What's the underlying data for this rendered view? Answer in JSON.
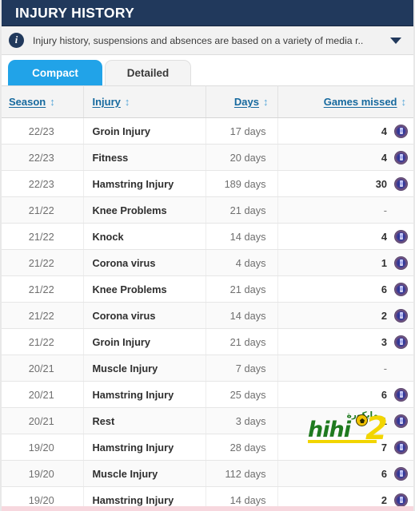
{
  "header": {
    "title": "INJURY HISTORY",
    "info_icon": "info-icon",
    "info_text": "Injury history, suspensions and absences are based on a variety of media r..",
    "expand_icon": "chevron-down-icon"
  },
  "tabs": [
    {
      "label": "Compact",
      "active": true
    },
    {
      "label": "Detailed",
      "active": false
    }
  ],
  "table": {
    "columns": [
      {
        "label": "Season",
        "sort": "↕",
        "align": "left"
      },
      {
        "label": "Injury",
        "sort": "↕",
        "align": "left"
      },
      {
        "label": "Days",
        "sort": "↕",
        "align": "right"
      },
      {
        "label": "Games missed",
        "sort": "↕",
        "align": "right"
      }
    ],
    "rows": [
      {
        "season": "22/23",
        "injury": "Groin Injury",
        "days": "17 days",
        "games": "4",
        "crest": true
      },
      {
        "season": "22/23",
        "injury": "Fitness",
        "days": "20 days",
        "games": "4",
        "crest": true
      },
      {
        "season": "22/23",
        "injury": "Hamstring Injury",
        "days": "189 days",
        "games": "30",
        "crest": true
      },
      {
        "season": "21/22",
        "injury": "Knee Problems",
        "days": "21 days",
        "games": "-",
        "crest": false
      },
      {
        "season": "21/22",
        "injury": "Knock",
        "days": "14 days",
        "games": "4",
        "crest": true
      },
      {
        "season": "21/22",
        "injury": "Corona virus",
        "days": "4 days",
        "games": "1",
        "crest": true
      },
      {
        "season": "21/22",
        "injury": "Knee Problems",
        "days": "21 days",
        "games": "6",
        "crest": true
      },
      {
        "season": "21/22",
        "injury": "Corona virus",
        "days": "14 days",
        "games": "2",
        "crest": true
      },
      {
        "season": "21/22",
        "injury": "Groin Injury",
        "days": "21 days",
        "games": "3",
        "crest": true
      },
      {
        "season": "20/21",
        "injury": "Muscle Injury",
        "days": "7 days",
        "games": "-",
        "crest": false
      },
      {
        "season": "20/21",
        "injury": "Hamstring Injury",
        "days": "25 days",
        "games": "6",
        "crest": true
      },
      {
        "season": "20/21",
        "injury": "Rest",
        "days": "3 days",
        "games": "1",
        "crest": true
      },
      {
        "season": "19/20",
        "injury": "Hamstring Injury",
        "days": "28 days",
        "games": "7",
        "crest": true
      },
      {
        "season": "19/20",
        "injury": "Muscle Injury",
        "days": "112 days",
        "games": "6",
        "crest": true
      },
      {
        "season": "19/20",
        "injury": "Hamstring Injury",
        "days": "14 days",
        "games": "2",
        "crest": true
      }
    ]
  },
  "watermark": {
    "arabic": "مايكورة",
    "name": "hihi",
    "digit": "2"
  },
  "colors": {
    "title_bar": "#21395c",
    "active_tab": "#21a3e8",
    "header_link": "#16699e",
    "bottom_band": "#f7d7de"
  }
}
